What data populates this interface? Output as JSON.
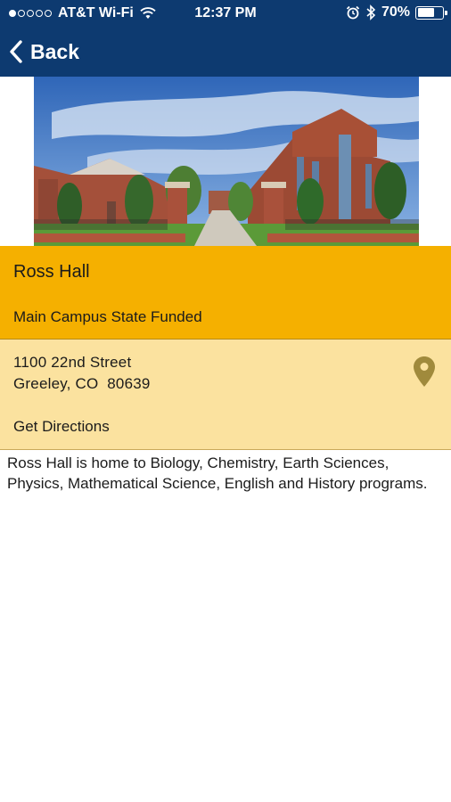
{
  "status_bar": {
    "carrier": "AT&T Wi-Fi",
    "time": "12:37 PM",
    "battery_percent": "70%",
    "battery_level": 0.7,
    "signal_bars_filled": 1,
    "signal_bars_total": 5
  },
  "nav": {
    "back_label": "Back"
  },
  "hero": {
    "icon": "building-photo"
  },
  "building": {
    "name": "Ross Hall",
    "type": "Main Campus State Funded",
    "address_line1": "1100 22nd Street",
    "address_line2": "Greeley, CO  80639",
    "directions_label": "Get Directions",
    "description": "Ross Hall is home to Biology, Chemistry, Earth Sciences, Physics, Mathematical Science, English and History programs."
  },
  "colors": {
    "header": "#0d3a70",
    "title_block": "#f5b000",
    "address_block": "#fbe29f",
    "pin": "#a08a3c"
  }
}
